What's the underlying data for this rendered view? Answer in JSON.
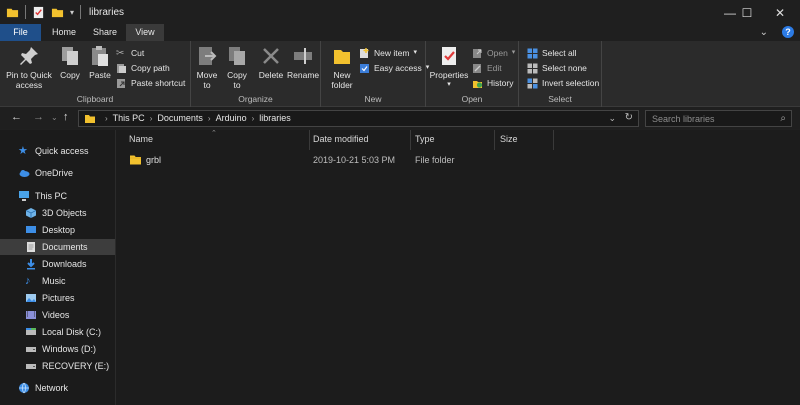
{
  "window": {
    "title": "libraries",
    "controls": {
      "minimize": "—",
      "maximize": "☐",
      "close": "✕"
    }
  },
  "tabs": [
    {
      "label": "File"
    },
    {
      "label": "Home"
    },
    {
      "label": "Share"
    },
    {
      "label": "View"
    }
  ],
  "ribbon": {
    "clipboard": {
      "label": "Clipboard",
      "pin_line1": "Pin to Quick",
      "pin_line2": "access",
      "copy": "Copy",
      "paste": "Paste",
      "cut": "Cut",
      "copy_path": "Copy path",
      "paste_shortcut": "Paste shortcut"
    },
    "organize": {
      "label": "Organize",
      "move_line1": "Move",
      "move_line2": "to",
      "copy_line1": "Copy",
      "copy_line2": "to",
      "delete": "Delete",
      "rename": "Rename"
    },
    "new": {
      "label": "New",
      "folder_line1": "New",
      "folder_line2": "folder",
      "new_item": "New item",
      "easy_access": "Easy access"
    },
    "open": {
      "label": "Open",
      "properties": "Properties",
      "open": "Open",
      "edit": "Edit",
      "history": "History"
    },
    "select": {
      "label": "Select",
      "select_all": "Select all",
      "select_none": "Select none",
      "invert": "Invert selection"
    }
  },
  "address": {
    "crumbs": [
      "This PC",
      "Documents",
      "Arduino",
      "libraries"
    ],
    "search_placeholder": "Search libraries"
  },
  "nav": {
    "quick_access": "Quick access",
    "onedrive": "OneDrive",
    "this_pc": "This PC",
    "objects3d": "3D Objects",
    "desktop": "Desktop",
    "documents": "Documents",
    "downloads": "Downloads",
    "music": "Music",
    "pictures": "Pictures",
    "videos": "Videos",
    "local_disk": "Local Disk (C:)",
    "windows_d": "Windows (D:)",
    "recovery_e": "RECOVERY (E:)",
    "network": "Network"
  },
  "columns": {
    "name": "Name",
    "date": "Date modified",
    "type": "Type",
    "size": "Size"
  },
  "files": [
    {
      "name": "grbl",
      "date": "2019-10-21 5:03 PM",
      "type": "File folder",
      "size": ""
    }
  ],
  "colors": {
    "accent": "#1f4f8a",
    "folder": "#f2c12e",
    "background": "#202020"
  }
}
